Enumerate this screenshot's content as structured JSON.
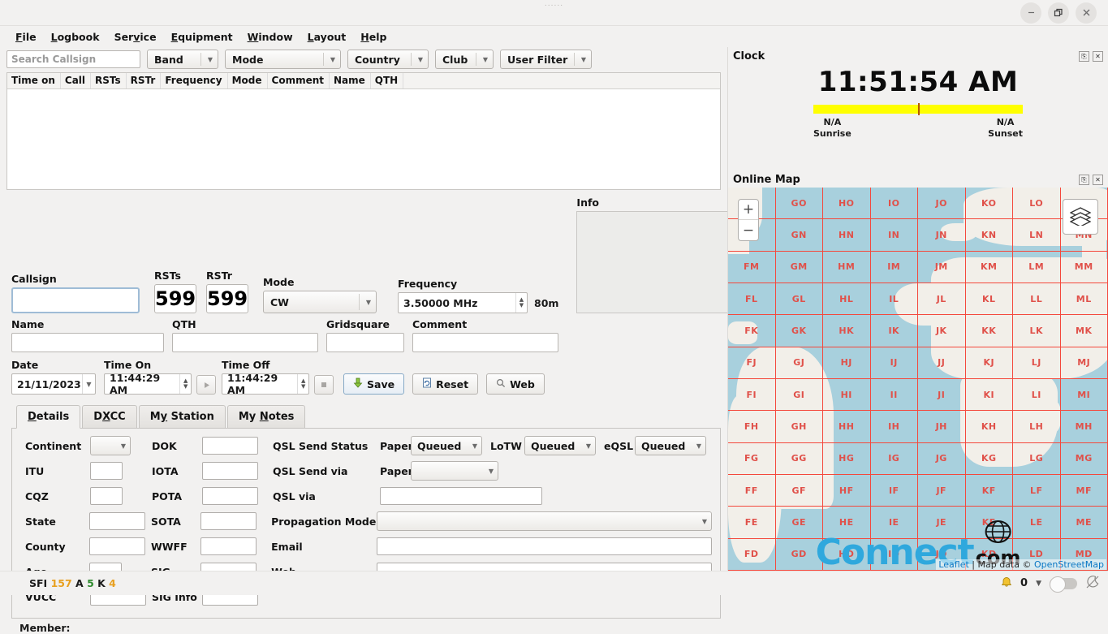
{
  "window": {
    "controls": [
      {
        "name": "minimize",
        "glyph": "—"
      },
      {
        "name": "maximize",
        "glyph": "❐"
      },
      {
        "name": "close",
        "glyph": "✕"
      }
    ]
  },
  "menubar": {
    "items": [
      {
        "label": "File",
        "mnemonic": "F"
      },
      {
        "label": "Logbook",
        "mnemonic": "L"
      },
      {
        "label": "Service",
        "mnemonic": "v"
      },
      {
        "label": "Equipment",
        "mnemonic": "E"
      },
      {
        "label": "Window",
        "mnemonic": "W"
      },
      {
        "label": "Layout",
        "mnemonic": "L"
      },
      {
        "label": "Help",
        "mnemonic": "H"
      }
    ]
  },
  "filters": {
    "search_placeholder": "Search Callsign",
    "search_value": "",
    "band": "Band",
    "mode": "Mode",
    "country": "Country",
    "club": "Club",
    "user_filter": "User Filter"
  },
  "qso_table": {
    "columns": [
      "Time on",
      "Call",
      "RSTs",
      "RSTr",
      "Frequency",
      "Mode",
      "Comment",
      "Name",
      "QTH"
    ],
    "rows": []
  },
  "entry": {
    "callsign_label": "Callsign",
    "callsign_value": "",
    "rsts_label": "RSTs",
    "rsts_value": "599",
    "rstr_label": "RSTr",
    "rstr_value": "599",
    "mode_label": "Mode",
    "mode_value": "CW",
    "frequency_label": "Frequency",
    "frequency_value": "3.50000 MHz",
    "band_value": "80m",
    "info_label": "Info",
    "info_value": "",
    "name_label": "Name",
    "name_value": "",
    "qth_label": "QTH",
    "qth_value": "",
    "gridsquare_label": "Gridsquare",
    "gridsquare_value": "",
    "comment_label": "Comment",
    "comment_value": "",
    "date_label": "Date",
    "date_value": "21/11/2023",
    "time_on_label": "Time On",
    "time_on_value": "11:44:29 AM",
    "time_off_label": "Time Off",
    "time_off_value": "11:44:29 AM",
    "save_label": "Save",
    "reset_label": "Reset",
    "web_label": "Web"
  },
  "tabs": [
    {
      "label": "Details",
      "mnemonic": "D",
      "active": true
    },
    {
      "label": "DXCC",
      "mnemonic": "X",
      "active": false
    },
    {
      "label": "My Station",
      "mnemonic": "y",
      "active": false
    },
    {
      "label": "My Notes",
      "mnemonic": "N",
      "active": false
    }
  ],
  "details": {
    "col1": [
      {
        "label": "Continent",
        "type": "combo",
        "value": ""
      },
      {
        "label": "ITU",
        "type": "input",
        "value": ""
      },
      {
        "label": "CQZ",
        "type": "input",
        "value": ""
      },
      {
        "label": "State",
        "type": "input",
        "value": ""
      },
      {
        "label": "County",
        "type": "input",
        "value": ""
      },
      {
        "label": "Age",
        "type": "input",
        "value": ""
      },
      {
        "label": "VUCC",
        "type": "input",
        "value": ""
      }
    ],
    "col2": [
      {
        "label": "DOK",
        "value": ""
      },
      {
        "label": "IOTA",
        "value": ""
      },
      {
        "label": "POTA",
        "value": ""
      },
      {
        "label": "SOTA",
        "value": ""
      },
      {
        "label": "WWFF",
        "value": ""
      },
      {
        "label": "SIG",
        "value": ""
      },
      {
        "label": "SIG Info",
        "value": ""
      }
    ],
    "qsl_send_status_label": "QSL Send Status",
    "qsl_send_via_label": "QSL Send via",
    "qsl_via_label": "QSL via",
    "propagation_mode_label": "Propagation Mode",
    "email_label": "Email",
    "web_label": "Web",
    "paper_label": "Paper",
    "paper_status": "Queued",
    "lotw_label": "LoTW",
    "lotw_status": "Queued",
    "eqsl_label": "eQSL",
    "eqsl_status": "Queued",
    "paper_via_label": "Paper",
    "paper_via_value": "",
    "qsl_via_value": "",
    "propagation_mode_value": "",
    "email_value": "",
    "web_value": ""
  },
  "member": {
    "label": "Member:",
    "value": ""
  },
  "status": {
    "sfi_label": "SFI",
    "sfi_value": "157",
    "a_label": "A",
    "a_value": "5",
    "k_label": "K",
    "k_value": "4",
    "notification_count": "0",
    "sfi_color": "#e8a020",
    "a_color": "#2f8a2f",
    "k_color": "#e8a020"
  },
  "clock": {
    "title": "Clock",
    "time": "11:51:54 AM",
    "sunrise_value": "N/A",
    "sunrise_label": "Sunrise",
    "sunset_value": "N/A",
    "sunset_label": "Sunset",
    "daybar_color": "#ffff00"
  },
  "map": {
    "title": "Online Map",
    "zoom_in": "+",
    "zoom_out": "−",
    "grid_columns": [
      "F",
      "G",
      "H",
      "I",
      "J",
      "K",
      "L",
      "M"
    ],
    "grid_rows": [
      "O",
      "N",
      "M",
      "L",
      "K",
      "J",
      "I",
      "H",
      "G",
      "F",
      "E",
      "D"
    ],
    "attribution_leaflet": "Leaflet",
    "attribution_text": " | Map data © ",
    "attribution_osm": "OpenStreetMap",
    "watermark_main": "onnect",
    "watermark_c": "C",
    "watermark_com": "com",
    "watermark_www": "www"
  }
}
